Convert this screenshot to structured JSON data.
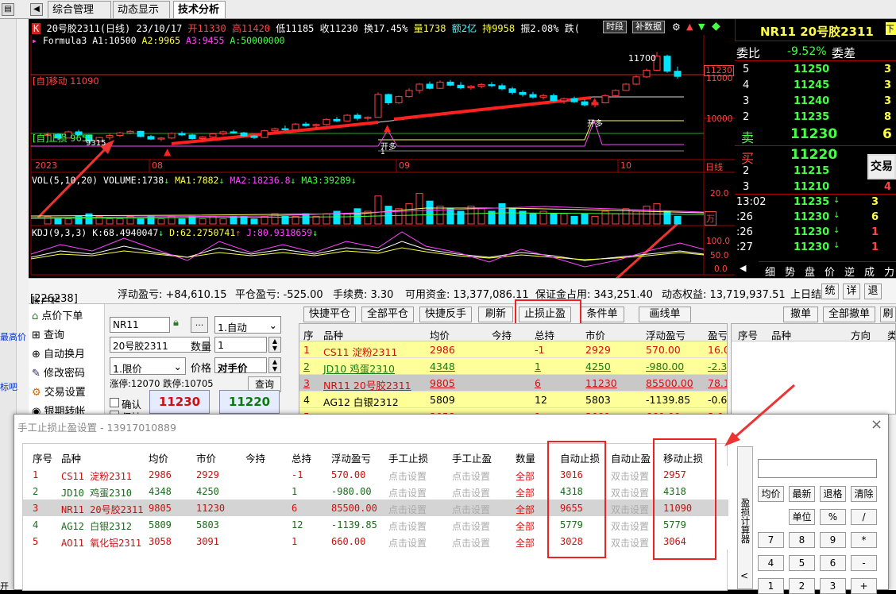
{
  "tabs": [
    "综合管理",
    "动态显示牌",
    "技术分析"
  ],
  "left_sidebar": {
    "text1": "最高价",
    "text2": "标吧",
    "text3": "开"
  },
  "chart": {
    "header": {
      "name": "20号胶2311(日线)",
      "date": "23/10/17",
      "open": "开11330",
      "high": "高11420",
      "low": "低11185",
      "close": "收11230",
      "change": "换17.45%",
      "volume": "量1738",
      "amount": "额2亿",
      "hold": "持9958",
      "amplitude": "振2.08%",
      "fall": "跌(",
      "btn_time": "时段",
      "btn_fill": "补数据"
    },
    "formula": {
      "name": "Formula3",
      "a1": "A1:10500",
      "a2": "A2:9965",
      "a3": "A3:9455",
      "a": "A:50000000"
    },
    "labels": {
      "move_stop": "[自]移动 11090",
      "stop_loss": "[自]止损 9655",
      "low_mark": "9315",
      "high_mark": "11700",
      "open_long": "开多",
      "open_long_num": "1",
      "price_tag": "11230"
    },
    "yaxis": [
      "11000",
      "10000"
    ],
    "xaxis": [
      "2023",
      "08",
      "09",
      "10",
      "日线"
    ],
    "vol": {
      "title": "VOL(5,10,20)",
      "volume": "VOLUME:1738",
      "ma1": "MA1:7882",
      "ma2": "MA2:18236.8",
      "ma3": "MA3:39289",
      "y20": "20.0",
      "unit": "万"
    },
    "kdj": {
      "title": "KDJ(9,3,3)",
      "k": "K:68.4940047",
      "d": "D:62.2750741",
      "j": "J:80.9318659",
      "y100": "100.0",
      "y50": "50.0",
      "y0": "0.0"
    },
    "candles": [
      [
        10090,
        10150,
        10020,
        10110
      ],
      [
        10110,
        10130,
        10000,
        10040
      ],
      [
        10040,
        10180,
        10030,
        10160
      ],
      [
        10160,
        10200,
        10080,
        10100
      ],
      [
        10100,
        10110,
        9960,
        9980
      ],
      [
        9980,
        10060,
        9950,
        10050
      ],
      [
        10050,
        10120,
        10000,
        10090
      ],
      [
        10090,
        10160,
        10060,
        10140
      ],
      [
        10140,
        10190,
        10110,
        10170
      ],
      [
        10170,
        10180,
        10050,
        10070
      ],
      [
        10070,
        10100,
        10000,
        10020
      ],
      [
        10020,
        10060,
        9980,
        10040
      ],
      [
        10040,
        10150,
        10020,
        10130
      ],
      [
        10130,
        10170,
        10080,
        10100
      ],
      [
        10100,
        10120,
        10010,
        10030
      ],
      [
        10030,
        10080,
        10000,
        10060
      ],
      [
        10060,
        10140,
        10040,
        10120
      ],
      [
        10120,
        10180,
        10090,
        10160
      ],
      [
        10160,
        10200,
        10120,
        10140
      ],
      [
        10140,
        10160,
        10060,
        10080
      ],
      [
        10080,
        10100,
        10020,
        10050
      ],
      [
        10050,
        10200,
        10040,
        10180
      ],
      [
        10180,
        10240,
        10150,
        10220
      ],
      [
        10220,
        10280,
        10180,
        10200
      ],
      [
        10200,
        10330,
        10190,
        10310
      ],
      [
        10310,
        10350,
        10260,
        10280
      ],
      [
        10280,
        10320,
        10220,
        10300
      ],
      [
        10300,
        10420,
        10280,
        10400
      ],
      [
        10400,
        10450,
        10350,
        10370
      ],
      [
        10370,
        10500,
        10360,
        10480
      ],
      [
        10480,
        10520,
        10380,
        10420
      ],
      [
        10420,
        10460,
        10380,
        10440
      ],
      [
        10440,
        10920,
        10430,
        10880
      ],
      [
        10880,
        10900,
        10680,
        10720
      ],
      [
        10720,
        10860,
        10700,
        10840
      ],
      [
        10840,
        11000,
        10820,
        10960
      ],
      [
        10960,
        11100,
        10900,
        11080
      ],
      [
        11080,
        11130,
        10980,
        11000
      ],
      [
        11000,
        11150,
        10990,
        11120
      ],
      [
        11120,
        11160,
        11040,
        11060
      ],
      [
        11060,
        11120,
        10980,
        11010
      ],
      [
        11010,
        11060,
        10970,
        11040
      ],
      [
        11040,
        11100,
        11000,
        11070
      ],
      [
        11070,
        11120,
        11020,
        11050
      ],
      [
        11050,
        11090,
        10960,
        10990
      ],
      [
        10990,
        11030,
        10880,
        10920
      ],
      [
        10920,
        10960,
        10840,
        10880
      ],
      [
        10880,
        10930,
        10800,
        10830
      ],
      [
        10830,
        10890,
        10780,
        10860
      ],
      [
        10860,
        10900,
        10740,
        10760
      ],
      [
        10760,
        10820,
        10700,
        10800
      ],
      [
        10800,
        10840,
        10720,
        10740
      ],
      [
        10740,
        10780,
        10650,
        10680
      ],
      [
        10680,
        10740,
        10630,
        10720
      ],
      [
        10720,
        10880,
        10710,
        10860
      ],
      [
        10860,
        10980,
        10850,
        10960
      ],
      [
        10960,
        11100,
        10950,
        11080
      ],
      [
        11080,
        11250,
        11060,
        11220
      ],
      [
        11220,
        11380,
        11200,
        11350
      ],
      [
        11350,
        11700,
        11330,
        11620
      ],
      [
        11620,
        11650,
        11300,
        11330
      ],
      [
        11330,
        11420,
        11185,
        11230
      ]
    ],
    "volumes": [
      3,
      2,
      2,
      3,
      4,
      3,
      2,
      2,
      3,
      2,
      3,
      2,
      3,
      2,
      3,
      2,
      3,
      2,
      3,
      3,
      2,
      3,
      4,
      3,
      3,
      4,
      3,
      4,
      5,
      4,
      6,
      5,
      11,
      7,
      6,
      8,
      12,
      9,
      7,
      6,
      5,
      7,
      6,
      5,
      8,
      6,
      5,
      4,
      5,
      4,
      4,
      3,
      4,
      3,
      5,
      4,
      6,
      5,
      7,
      8,
      5,
      3
    ]
  },
  "quote": {
    "title": "NR11 20号胶2311",
    "ratio_label": "委比",
    "ratio": "-9.52%",
    "diff_label": "委差",
    "asks": [
      {
        "lvl": "5",
        "price": "11250",
        "vol": "3"
      },
      {
        "lvl": "4",
        "price": "11245",
        "vol": "3"
      },
      {
        "lvl": "3",
        "price": "11240",
        "vol": "3"
      },
      {
        "lvl": "2",
        "price": "11235",
        "vol": "8"
      }
    ],
    "sell": {
      "label": "卖",
      "price": "11230",
      "vol": "6"
    },
    "buy": {
      "label": "买",
      "price": "11220"
    },
    "bids": [
      {
        "lvl": "2",
        "price": "11215"
      },
      {
        "lvl": "3",
        "price": "11210",
        "vol": "4"
      }
    ],
    "trade_btn": "交易",
    "ticks": [
      {
        "t": "13:02",
        "p": "11235",
        "v": "3"
      },
      {
        "t": ":26",
        "p": "11230",
        "v": "6"
      },
      {
        "t": ":26",
        "p": "11230",
        "v": "1"
      },
      {
        "t": ":27",
        "p": "11230",
        "v": "1"
      }
    ],
    "bottom_tabs": [
      "细",
      "势",
      "盘",
      "价",
      "逆",
      "成",
      "力"
    ]
  },
  "account": {
    "label": "账户栏",
    "id": "[226238]",
    "float": "浮动盈亏: +84,610.15",
    "close": "平仓盈亏: -525.00",
    "fee": "手续费: 3.30",
    "avail": "可用资金: 13,377,086.11",
    "margin": "保证金占用: 343,251.40",
    "equity": "动态权益: 13,719,937.51",
    "prev": "上日结",
    "btns": [
      "统",
      "详",
      "退"
    ]
  },
  "order_menu": [
    "点价下单",
    "查询",
    "自动换月",
    "修改密码",
    "交易设置",
    "银期转帐"
  ],
  "order_form": {
    "code": "NR11",
    "dots": "...",
    "mode": "1.自动",
    "name": "20号胶2311",
    "qty_label": "数量",
    "qty": "1",
    "price_type": "1.限价",
    "price_label": "价格",
    "price": "对手价",
    "limit_up": "涨停:12070",
    "limit_down": "跌停:10705",
    "query": "查询",
    "confirm": "确认",
    "sell_price": "11230",
    "buy_price": "11220",
    "keep": "保持"
  },
  "toolbar": [
    "快捷平仓",
    "全部平仓",
    "快捷反手",
    "刷新",
    "止损止盈",
    "条件单",
    "画线单"
  ],
  "toolbar_right": [
    "撤单",
    "全部撤单",
    "刷"
  ],
  "positions": {
    "headers": [
      "序",
      "品种",
      "均价",
      "今持",
      "总持",
      "市价",
      "浮动盈亏",
      "盈亏"
    ],
    "rows": [
      [
        "1",
        "CS11 淀粉2311",
        "2986",
        "",
        "-1",
        "2929",
        "570.00",
        "16.0"
      ],
      [
        "2",
        "JD10 鸡蛋2310",
        "4348",
        "",
        "1",
        "4250",
        "-980.00",
        "-2.3"
      ],
      [
        "3",
        "NR11 20号胶2311",
        "9805",
        "",
        "6",
        "11230",
        "85500.00",
        "78.1"
      ],
      [
        "4",
        "AG12 白银2312",
        "5809",
        "",
        "12",
        "5803",
        "-1139.85",
        "-0.6"
      ],
      [
        "5",
        "AO11 氧化铝2311",
        "3058",
        "",
        "1",
        "3091",
        "660.00",
        "3.0"
      ]
    ]
  },
  "orders": {
    "headers": [
      "序号",
      "品种",
      "方向",
      "类"
    ]
  },
  "dialog": {
    "title": "手工止损止盈设置 - 13917010889",
    "close": "×",
    "headers": [
      "序号",
      "品种",
      "均价",
      "市价",
      "今持",
      "总持",
      "浮动盈亏",
      "手工止损",
      "手工止盈",
      "数量",
      "自动止损",
      "自动止盈",
      "移动止损"
    ],
    "rows": [
      [
        "1",
        "CS11 淀粉2311",
        "2986",
        "2929",
        "",
        "-1",
        "570.00",
        "点击设置",
        "点击设置",
        "全部",
        "3016",
        "双击设置",
        "2957"
      ],
      [
        "2",
        "JD10 鸡蛋2310",
        "4348",
        "4250",
        "",
        "1",
        "-980.00",
        "点击设置",
        "点击设置",
        "全部",
        "4318",
        "双击设置",
        "4318"
      ],
      [
        "3",
        "NR11 20号胶2311",
        "9805",
        "11230",
        "",
        "6",
        "85500.00",
        "点击设置",
        "点击设置",
        "全部",
        "9655",
        "双击设置",
        "11090"
      ],
      [
        "4",
        "AG12 白银2312",
        "5809",
        "5803",
        "",
        "12",
        "-1139.85",
        "点击设置",
        "点击设置",
        "全部",
        "5779",
        "双击设置",
        "5779"
      ],
      [
        "5",
        "AO11 氧化铝2311",
        "3058",
        "3091",
        "",
        "1",
        "660.00",
        "点击设置",
        "点击设置",
        "全部",
        "3028",
        "双击设置",
        "3064"
      ]
    ],
    "calc_label": "盈损计算器",
    "calc_arrow": "<",
    "calc_keys": [
      [
        "均价",
        "最新",
        "退格",
        "清除"
      ],
      [
        "单位",
        "%",
        "/"
      ],
      [
        "7",
        "8",
        "9",
        "*"
      ],
      [
        "4",
        "5",
        "6",
        "-"
      ],
      [
        "1",
        "2",
        "3",
        "+"
      ]
    ]
  },
  "colors": {
    "red": "#ff3333",
    "green": "#33ff33",
    "cyan": "#00ffff",
    "yellow": "#ffff00",
    "magenta": "#ff00ff"
  }
}
